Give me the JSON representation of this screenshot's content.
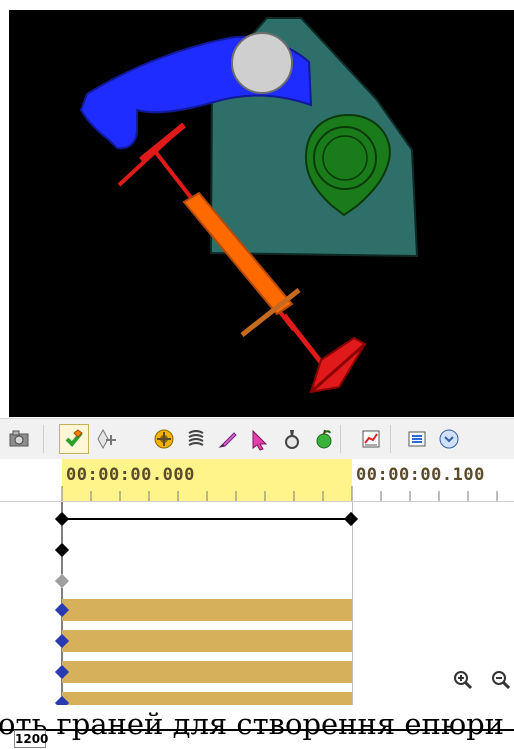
{
  "timeline": {
    "time_start": "00:00:00.000",
    "time_end": "00:00:00.100"
  },
  "caption": {
    "text": "оть граней для створення епюри",
    "number": "1200"
  },
  "icons": {
    "toolbar": [
      "camera-scene-icon",
      "green-check-key-icon",
      "add-key-icon",
      "gear-motor-icon",
      "spring-icon",
      "pencil-icon",
      "select-arrow-icon",
      "clamp-icon",
      "apple-icon",
      "chart-icon",
      "list-icon",
      "expand-more-icon"
    ],
    "zoom": [
      "zoom-in-icon",
      "zoom-out-icon"
    ]
  },
  "colors": {
    "rocker": "#1f2cff",
    "housing": "#2f6f6a",
    "cam": "#1a7b1a",
    "pushrod": "#ff6a00",
    "valve": "#e01a1a",
    "ruler_highlight": "#fff48a",
    "bands": "#d6b05b"
  }
}
